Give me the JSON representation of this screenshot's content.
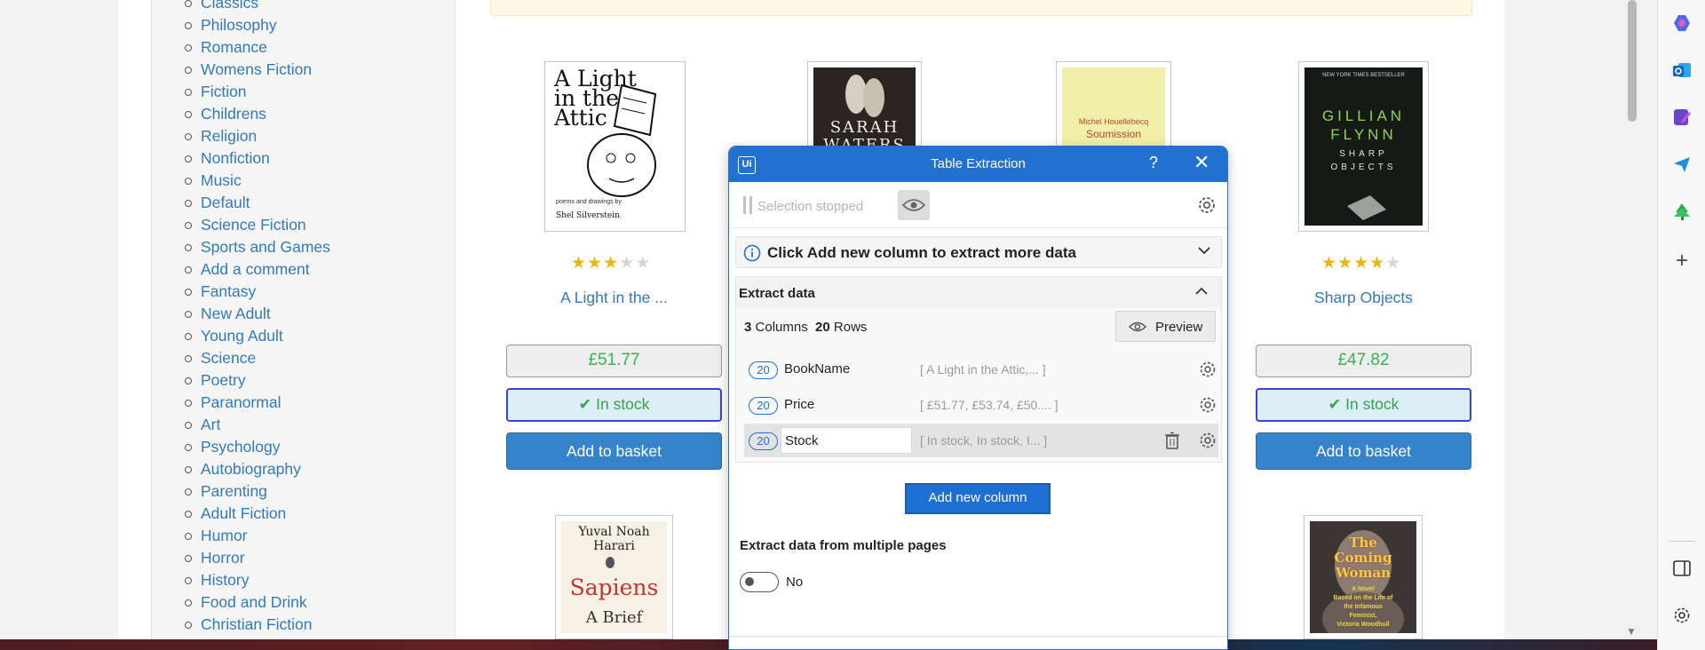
{
  "sidebar": {
    "categories": [
      "Classics",
      "Philosophy",
      "Romance",
      "Womens Fiction",
      "Fiction",
      "Childrens",
      "Religion",
      "Nonfiction",
      "Music",
      "Default",
      "Science Fiction",
      "Sports and Games",
      "Add a comment",
      "Fantasy",
      "New Adult",
      "Young Adult",
      "Science",
      "Poetry",
      "Paranormal",
      "Art",
      "Psychology",
      "Autobiography",
      "Parenting",
      "Adult Fiction",
      "Humor",
      "Horror",
      "History",
      "Food and Drink",
      "Christian Fiction"
    ]
  },
  "books": [
    {
      "cover_lines": [
        "A Light",
        "in the",
        "Attic"
      ],
      "cover_caption": "poems and drawings by",
      "cover_author": "Shel Silverstein",
      "rating": 3,
      "title": "A Light in the ...",
      "price": "£51.77",
      "stock": "In stock",
      "basket": "Add to basket"
    },
    {
      "cover_lines": [
        "SARAH",
        "WATERS"
      ]
    },
    {
      "cover_lines": [
        "Michel Houellebecq",
        "Soumission"
      ]
    },
    {
      "cover_lines": [
        "GILLIAN",
        "FLYNN",
        "SHARP",
        "OBJECTS"
      ],
      "cover_top": "NEW YORK TIMES BESTSELLER",
      "rating": 4,
      "title": "Sharp Objects",
      "price": "£47.82",
      "stock": "In stock",
      "basket": "Add to basket"
    },
    {
      "cover_lines": [
        "Yuval Noah",
        "Harari",
        "Sapiens",
        "A Brief"
      ]
    },
    {
      "cover_lines": [
        "The",
        "Coming",
        "Woman"
      ],
      "cover_small": [
        "A Novel",
        "Based on the Life of",
        "the Infamous",
        "Feminist,",
        "Victoria Woodhull"
      ]
    }
  ],
  "dialog": {
    "logo": "Ui",
    "title": "Table Extraction",
    "help": "?",
    "close": "✕",
    "selection_status": "Selection stopped",
    "info_text": "Click Add new column to extract more data",
    "extract_title": "Extract data",
    "columns_count": "3",
    "columns_label": "Columns",
    "rows_count": "20",
    "rows_label": "Rows",
    "preview_label": "Preview",
    "columns": [
      {
        "count": "20",
        "name": "BookName",
        "sample": "[ A Light in the Attic,...  ]"
      },
      {
        "count": "20",
        "name": "Price",
        "sample": "[ £51.77, £53.74, £50....  ]"
      },
      {
        "count": "20",
        "name": "Stock",
        "sample": "[  In stock,  In stock,  I...  ]"
      }
    ],
    "add_column_label": "Add new column",
    "multi_pages_label": "Extract data from multiple pages",
    "multi_pages_value": "No"
  },
  "colors": {
    "link": "#337ab7",
    "dialog_accent": "#2271d1",
    "price_green": "#3cb150",
    "basket_blue": "#3583cb"
  }
}
